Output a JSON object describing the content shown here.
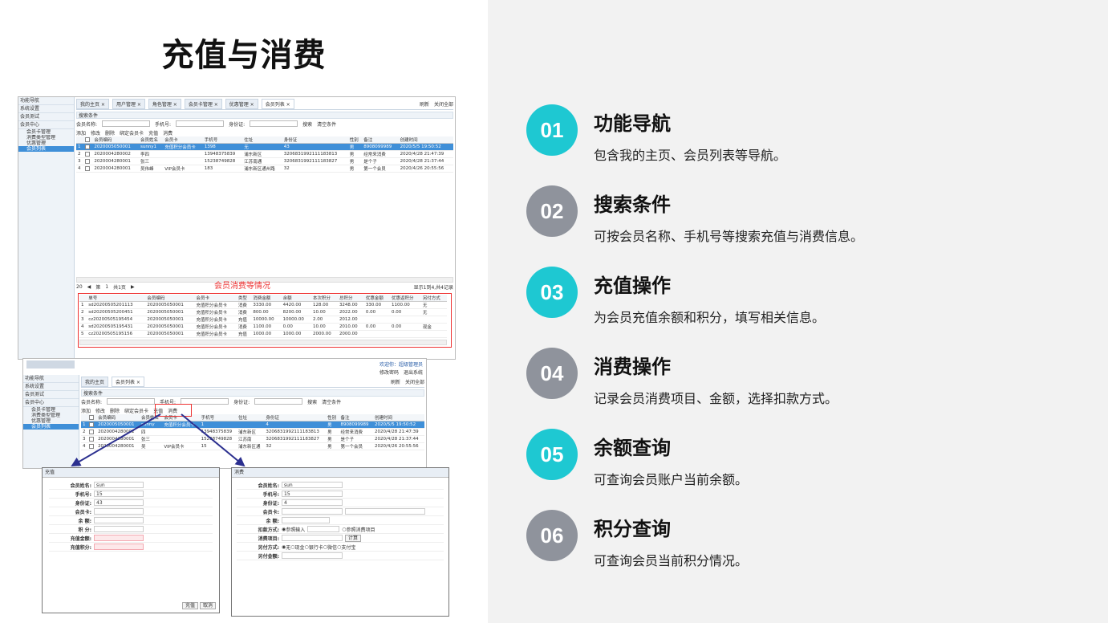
{
  "slide_title": "充值与消费",
  "screenshot1": {
    "sidebar": {
      "header": "功能导航",
      "items": [
        "系统设置",
        "会员测试",
        "会员中心"
      ],
      "subitems": [
        "会员卡管理",
        "消费类型管理",
        "优惠管理",
        "会员列表"
      ]
    },
    "tabs": [
      "我的主页 ×",
      "用户管理 ×",
      "角色管理 ×",
      "会员卡管理 ×",
      "优惠管理 ×",
      "会员列表 ×"
    ],
    "tab_actions": [
      "刷新",
      "关闭全部"
    ],
    "search": {
      "bar_title": "搜索条件",
      "name_label": "会员名称:",
      "phone_label": "手机号:",
      "id_label": "身份证:",
      "search_btn": "搜索",
      "clear_btn": "清空条件"
    },
    "toolbar": [
      "添加",
      "修改",
      "删除",
      "绑定会员卡",
      "充值",
      "消费"
    ],
    "member_headers": [
      "",
      "",
      "会员编码",
      "会员姓名",
      "会员卡",
      "手机号",
      "住址",
      "身份证",
      "性别",
      "备注",
      "创建时间"
    ],
    "members": [
      [
        "1",
        "2020005050001",
        "sunny1",
        "充值积分会员卡",
        "1398",
        "无",
        "43",
        "男",
        "8908099989",
        "2020/5/5 19:50:52"
      ],
      [
        "2",
        "2020004280002",
        "李四",
        "",
        "13948375839",
        "浦东新区",
        "3206831992111183813",
        "男",
        "经常来消费",
        "2020/4/28 21:47:39"
      ],
      [
        "3",
        "2020004280001",
        "张三",
        "",
        "15238749828",
        "江苏南通",
        "3206831992111183827",
        "男",
        "是个子",
        "2020/4/28 21:37:44"
      ],
      [
        "4",
        "2020004280001",
        "吴伟峰",
        "VIP会员卡",
        "183",
        "浦东新区通州路",
        "32",
        "男",
        "第一个会员",
        "2020/4/26 20:55:56"
      ]
    ],
    "pager": {
      "page_size": "20",
      "page_prefix": "第",
      "page": "1",
      "page_total": "共1页",
      "info": "显示1到4,共4记录"
    },
    "consume_label": "会员消费等情况",
    "consume_headers": [
      "",
      "单号",
      "会员编码",
      "会员卡",
      "类型",
      "消费金额",
      "余额",
      "本次积分",
      "总积分",
      "优惠金额",
      "优惠返积分",
      "另付方式"
    ],
    "consumes": [
      [
        "1",
        "sd20200505201113",
        "2020005050001",
        "充值积分会员卡",
        "消费",
        "3330.00",
        "4420.00",
        "128.00",
        "3248.00",
        "330.00",
        "1100.00",
        "无"
      ],
      [
        "2",
        "sd20200505200451",
        "2020005050001",
        "充值积分会员卡",
        "消费",
        "800.00",
        "8200.00",
        "10.00",
        "2022.00",
        "0.00",
        "0.00",
        "无"
      ],
      [
        "3",
        "cz20200505195454",
        "2020005050001",
        "充值积分会员卡",
        "充值",
        "10000.00",
        "10000.00",
        "2.00",
        "2012.00",
        "",
        "",
        ""
      ],
      [
        "4",
        "sd20200505195431",
        "2020005050001",
        "充值积分会员卡",
        "消费",
        "1100.00",
        "0.00",
        "10.00",
        "2010.00",
        "0.00",
        "0.00",
        "现金"
      ],
      [
        "5",
        "cz20200505195156",
        "2020005050001",
        "充值积分会员卡",
        "充值",
        "1000.00",
        "1000.00",
        "2000.00",
        "2000.00",
        "",
        "",
        ""
      ]
    ]
  },
  "screenshot2": {
    "welcome": "欢迎你：超级管理员",
    "top_actions": [
      "修改密码",
      "退出系统"
    ],
    "sidebar": {
      "header": "功能导航",
      "items": [
        "系统设置",
        "会员测试",
        "会员中心"
      ],
      "subitems": [
        "会员卡管理",
        "消费类型管理",
        "优惠管理",
        "会员列表"
      ]
    },
    "tabs": [
      "我的主页",
      "会员列表 ×"
    ],
    "tab_actions": [
      "刷新",
      "关闭全部"
    ],
    "toolbar": [
      "添加",
      "修改",
      "删除",
      "绑定会员卡",
      "充值",
      "消费"
    ],
    "member_headers": [
      "",
      "",
      "会员编码",
      "会员姓名",
      "会员卡",
      "手机号",
      "住址",
      "身份证",
      "性别",
      "备注",
      "创建时间"
    ],
    "members": [
      [
        "1",
        "2020005050001",
        "sunny",
        "充值积分会员卡",
        "1",
        "",
        "4",
        "男",
        "8908099989",
        "2020/5/5 19:50:52"
      ],
      [
        "2",
        "2020004280002",
        "四",
        "",
        "13948375839",
        "浦东新区",
        "3206831992111183813",
        "男",
        "经常来消费",
        "2020/4/28 21:47:39"
      ],
      [
        "3",
        "2020004280001",
        "张三",
        "",
        "15238749828",
        "江苏南",
        "3206831992111183827",
        "男",
        "是个子",
        "2020/4/28 21:37:44"
      ],
      [
        "4",
        "2020004280001",
        "吴",
        "VIP会员卡",
        "15",
        "浦东新区通",
        "32",
        "男",
        "第一个会员",
        "2020/4/26 20:55:56"
      ]
    ]
  },
  "recharge_dialog": {
    "title": "充值",
    "fields": [
      {
        "label": "会员姓名:",
        "value": "sun"
      },
      {
        "label": "手机号:",
        "value": "15"
      },
      {
        "label": "身份证:",
        "value": "43"
      },
      {
        "label": "会员卡:",
        "value": ""
      },
      {
        "label": "余 额:",
        "value": ""
      },
      {
        "label": "积 分:",
        "value": ""
      },
      {
        "label": "充值金额:",
        "value": ""
      },
      {
        "label": "充值积分:",
        "value": ""
      }
    ],
    "ok": "充值",
    "cancel": "取消"
  },
  "consume_dialog": {
    "title": "消费",
    "name_label": "会员姓名:",
    "name_value": "sun",
    "phone_label": "手机号:",
    "phone_value": "15",
    "id_label": "身份证:",
    "id_value": "4",
    "card_label": "会员卡:",
    "balance_label": "余 额:",
    "deduct_label": "扣款方式:",
    "deduct_opt1": "参照输入",
    "deduct_opt2": "参照消费项目",
    "item_label": "消费项目:",
    "calc_btn": "计算",
    "pay_label": "另付方式:",
    "pay_opts": [
      "无",
      "现金",
      "银行卡",
      "微信",
      "支付宝"
    ],
    "extra_label": "另付金额:"
  },
  "features": [
    {
      "num": "01",
      "title": "功能导航",
      "desc": "包含我的主页、会员列表等导航。",
      "color": "#1ec8d2"
    },
    {
      "num": "02",
      "title": "搜索条件",
      "desc": "可按会员名称、手机号等搜索充值与消费信息。",
      "color": "#8f939c"
    },
    {
      "num": "03",
      "title": "充值操作",
      "desc": "为会员充值余额和积分，填写相关信息。",
      "color": "#1ec8d2"
    },
    {
      "num": "04",
      "title": "消费操作",
      "desc": "记录会员消费项目、金额，选择扣款方式。",
      "color": "#8f939c"
    },
    {
      "num": "05",
      "title": "余额查询",
      "desc": "可查询会员账户当前余额。",
      "color": "#1ec8d2"
    },
    {
      "num": "06",
      "title": "积分查询",
      "desc": "可查询会员当前积分情况。",
      "color": "#8f939c"
    }
  ]
}
